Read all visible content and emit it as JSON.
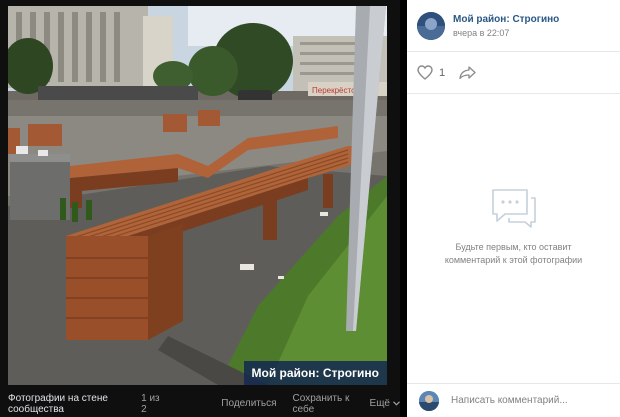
{
  "photo": {
    "caption": "Мой район: Строгино",
    "sign_text": "Перекрёсток"
  },
  "viewer_bar": {
    "album": "Фотографии на стене сообщества",
    "counter": "1 из 2",
    "share": "Поделиться",
    "save": "Сохранить к себе",
    "more": "Ещё"
  },
  "post": {
    "group_name": "Мой район: Строгино",
    "time": "вчера в 22:07",
    "likes": "1"
  },
  "comments": {
    "empty_text": "Будьте первым, кто оставит комментарий к этой фотографии",
    "placeholder": "Написать комментарий..."
  },
  "colors": {
    "link": "#2a5885",
    "caption_bg": "#142850",
    "wood": "#9a4f2b"
  }
}
